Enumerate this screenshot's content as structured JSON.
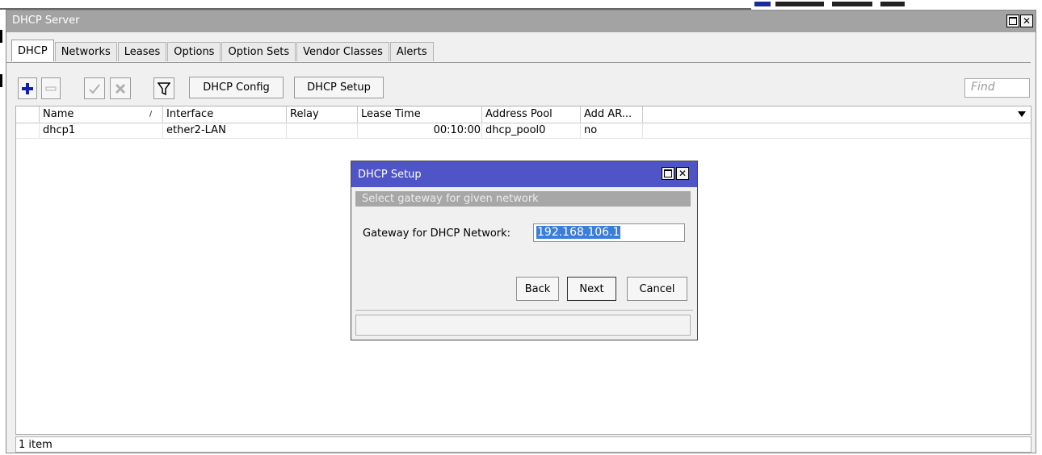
{
  "window": {
    "title": "DHCP Server"
  },
  "tabs": [
    {
      "label": "DHCP",
      "active": true
    },
    {
      "label": "Networks",
      "active": false
    },
    {
      "label": "Leases",
      "active": false
    },
    {
      "label": "Options",
      "active": false
    },
    {
      "label": "Option Sets",
      "active": false
    },
    {
      "label": "Vendor Classes",
      "active": false
    },
    {
      "label": "Alerts",
      "active": false
    }
  ],
  "toolbar": {
    "icons": [
      "add-icon",
      "remove-icon",
      "enable-icon",
      "disable-icon",
      "filter-icon"
    ],
    "dhcp_config_label": "DHCP Config",
    "dhcp_setup_label": "DHCP Setup",
    "find_placeholder": "Find"
  },
  "table": {
    "columns": [
      "Name",
      "Interface",
      "Relay",
      "Lease Time",
      "Address Pool",
      "Add AR..."
    ],
    "sorted_column": "Name",
    "rows": [
      {
        "name": "dhcp1",
        "interface": "ether2-LAN",
        "relay": "",
        "lease_time": "00:10:00",
        "address_pool": "dhcp_pool0",
        "add_arp": "no"
      }
    ]
  },
  "status": {
    "text": "1 item"
  },
  "dialog": {
    "title": "DHCP Setup",
    "subtitle": "Select gateway for given network",
    "field_label": "Gateway for DHCP Network:",
    "field_value": "192.168.106.1",
    "back_label": "Back",
    "next_label": "Next",
    "cancel_label": "Cancel"
  },
  "colors": {
    "titlebar": "#a3a3a3",
    "dialog_titlebar": "#4f54c6",
    "add_icon": "#1020a8",
    "selection": "#3a7ed9"
  }
}
